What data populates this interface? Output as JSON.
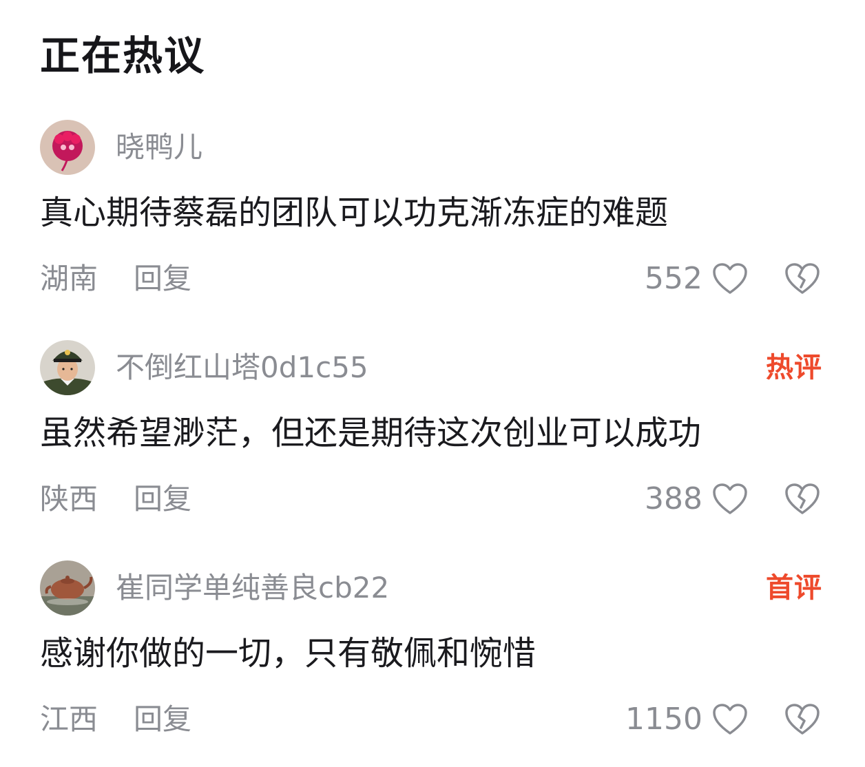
{
  "section": {
    "title": "正在热议"
  },
  "comments": [
    {
      "username": "晓鸭儿",
      "badge": "",
      "text": "真心期待蔡磊的团队可以功克渐冻症的难题",
      "location": "湖南",
      "reply_label": "回复",
      "likes": "552"
    },
    {
      "username": "不倒红山塔0d1c55",
      "badge": "热评",
      "text": "虽然希望渺茫，但还是期待这次创业可以成功",
      "location": "陕西",
      "reply_label": "回复",
      "likes": "388"
    },
    {
      "username": "崔同学单纯善良cb22",
      "badge": "首评",
      "text": "感谢你做的一切，只有敬佩和惋惜",
      "location": "江西",
      "reply_label": "回复",
      "likes": "1150"
    }
  ],
  "colors": {
    "badge": "#ee4a2c",
    "meta_text": "#8a8c92",
    "body_text": "#1a1a1e"
  },
  "icons": {
    "like": "heart-outline-icon",
    "dislike": "broken-heart-icon"
  }
}
